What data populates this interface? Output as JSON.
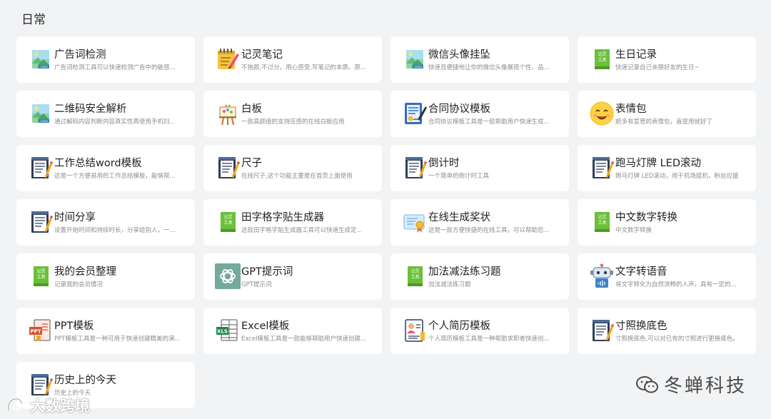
{
  "section": {
    "title": "日常"
  },
  "cards": [
    {
      "title": "广告词检测",
      "desc": "广告词检测工具可以快速检测广告中的敏感...",
      "icon": "image-placeholder-icon"
    },
    {
      "title": "记灵笔记",
      "desc": "不拖颜,不过分。用心感受,写笔记的本质。原...",
      "icon": "notepad-pencil-icon"
    },
    {
      "title": "微信头像挂坠",
      "desc": "快速且便捷地让你的微信头像展现个性、品...",
      "icon": "image-placeholder-icon"
    },
    {
      "title": "生日记录",
      "desc": "快速记录自己亲朋好友的生日~",
      "icon": "green-tool-book-icon"
    },
    {
      "title": "二维码安全解析",
      "desc": "通过解码内容判断内容真实性再使用手机扫...",
      "icon": "image-placeholder-icon"
    },
    {
      "title": "白板",
      "desc": "一款高颜值的支持压感的在线白板应用",
      "icon": "easel-icon"
    },
    {
      "title": "合同协议模板",
      "desc": "合同协议模板工具是一款帮助用户快速生成...",
      "icon": "contract-document-icon"
    },
    {
      "title": "表情包",
      "desc": "超多有意思的表情包，直接用就好了",
      "icon": "smiley-face-icon"
    },
    {
      "title": "工作总结word模板",
      "desc": "这是一个方便易用的工作总结模板，能够帮...",
      "icon": "document-pencil-icon"
    },
    {
      "title": "尺子",
      "desc": "在线尺子,这个功能主要是在首页上面使用",
      "icon": "document-pencil-icon"
    },
    {
      "title": "倒计时",
      "desc": "一个简单的倒计时工具",
      "icon": "document-pencil-icon"
    },
    {
      "title": "跑马灯牌 LED滚动",
      "desc": "跑马灯牌 LED滚动，用于机场接机，粉丝应援",
      "icon": "document-pencil-icon"
    },
    {
      "title": "时间分享",
      "desc": "设置开始时间和持续时长，分享给别人，一...",
      "icon": "document-pencil-icon"
    },
    {
      "title": "田字格字贴生成器",
      "desc": "这款田字格字贴生成器工具可以快速生成定...",
      "icon": "green-tool-book-icon"
    },
    {
      "title": "在线生成奖状",
      "desc": "这是一款方便快捷的在线工具，可以帮助您...",
      "icon": "certificate-icon"
    },
    {
      "title": "中文数字转换",
      "desc": "中文数字转换",
      "icon": "green-tool-book-icon"
    },
    {
      "title": "我的会员整理",
      "desc": "记录我的会员情况",
      "icon": "green-tool-book-icon"
    },
    {
      "title": "GPT提示词",
      "desc": "GPT提示词",
      "icon": "openai-logo-icon"
    },
    {
      "title": "加法减法练习题",
      "desc": "加法减法练习题",
      "icon": "green-tool-book-icon"
    },
    {
      "title": "文字转语音",
      "desc": "将文字转化为自然流畅的人声，具有一定的...",
      "icon": "robot-icon"
    },
    {
      "title": "PPT模板",
      "desc": "PPT模板工具是一种可用于快速创建精美的演...",
      "icon": "ppt-file-icon"
    },
    {
      "title": "Excel模板",
      "desc": "Excel模板工具是一款能够帮助用户快速创建...",
      "icon": "excel-file-icon"
    },
    {
      "title": "个人简历模板",
      "desc": "个人简历模板工具是一种帮助求职者快速创...",
      "icon": "resume-icon"
    },
    {
      "title": "寸照换底色",
      "desc": "寸照换底色,可以对已有的寸照进行更换底色。",
      "icon": "document-pencil-icon"
    },
    {
      "title": "历史上的今天",
      "desc": "历史上的今天",
      "icon": "document-pencil-icon"
    }
  ],
  "icon_labels": {
    "green_book": "记灵\n工具",
    "ppt": "PPT",
    "excel": "XLS"
  },
  "watermarks": {
    "right": "冬蝉科技",
    "left": "大数跨境"
  },
  "colors": {
    "background": "#f2f3f5",
    "card": "#ffffff",
    "title": "#1f1f1f",
    "desc": "#8d8d8d"
  }
}
